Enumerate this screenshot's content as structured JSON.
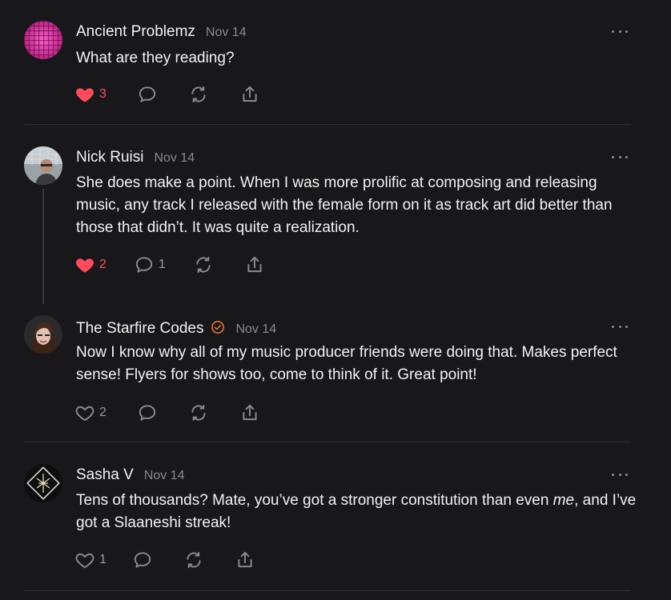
{
  "posts": [
    {
      "author": "Ancient Problemz",
      "date": "Nov 14",
      "text": "What are they reading?",
      "likes": "3",
      "liked": true,
      "replies": ""
    },
    {
      "author": "Nick Ruisi",
      "date": "Nov 14",
      "text": "She does make a point. When I was more prolific at composing and releasing music, any track I released with the female form on it as track art did better than those that didn’t. It was quite a realization.",
      "likes": "2",
      "liked": true,
      "replies": "1"
    },
    {
      "author": "The Starfire Codes",
      "date": "Nov 14",
      "text": "Now I know why all of my music producer friends were doing that. Makes perfect sense! Flyers for shows too, come to think of it. Great point!",
      "likes": "2",
      "liked": false,
      "replies": "",
      "verified": true
    },
    {
      "author": "Sasha V",
      "date": "Nov 14",
      "text_before": "Tens of thousands? Mate, you’ve got a stronger constitution than even ",
      "text_emphasis": "me",
      "text_after": ", and I’ve got a Slaaneshi streak!",
      "likes": "1",
      "liked": false,
      "replies": ""
    }
  ],
  "colors": {
    "background": "#18181a",
    "like_active": "#ff4b5a",
    "verified": "#f07a2a",
    "muted": "#8a8a8e"
  },
  "icons": {
    "like": "heart-icon",
    "reply": "comment-icon",
    "restack": "restack-icon",
    "share": "share-icon",
    "more": "more-options-icon"
  }
}
